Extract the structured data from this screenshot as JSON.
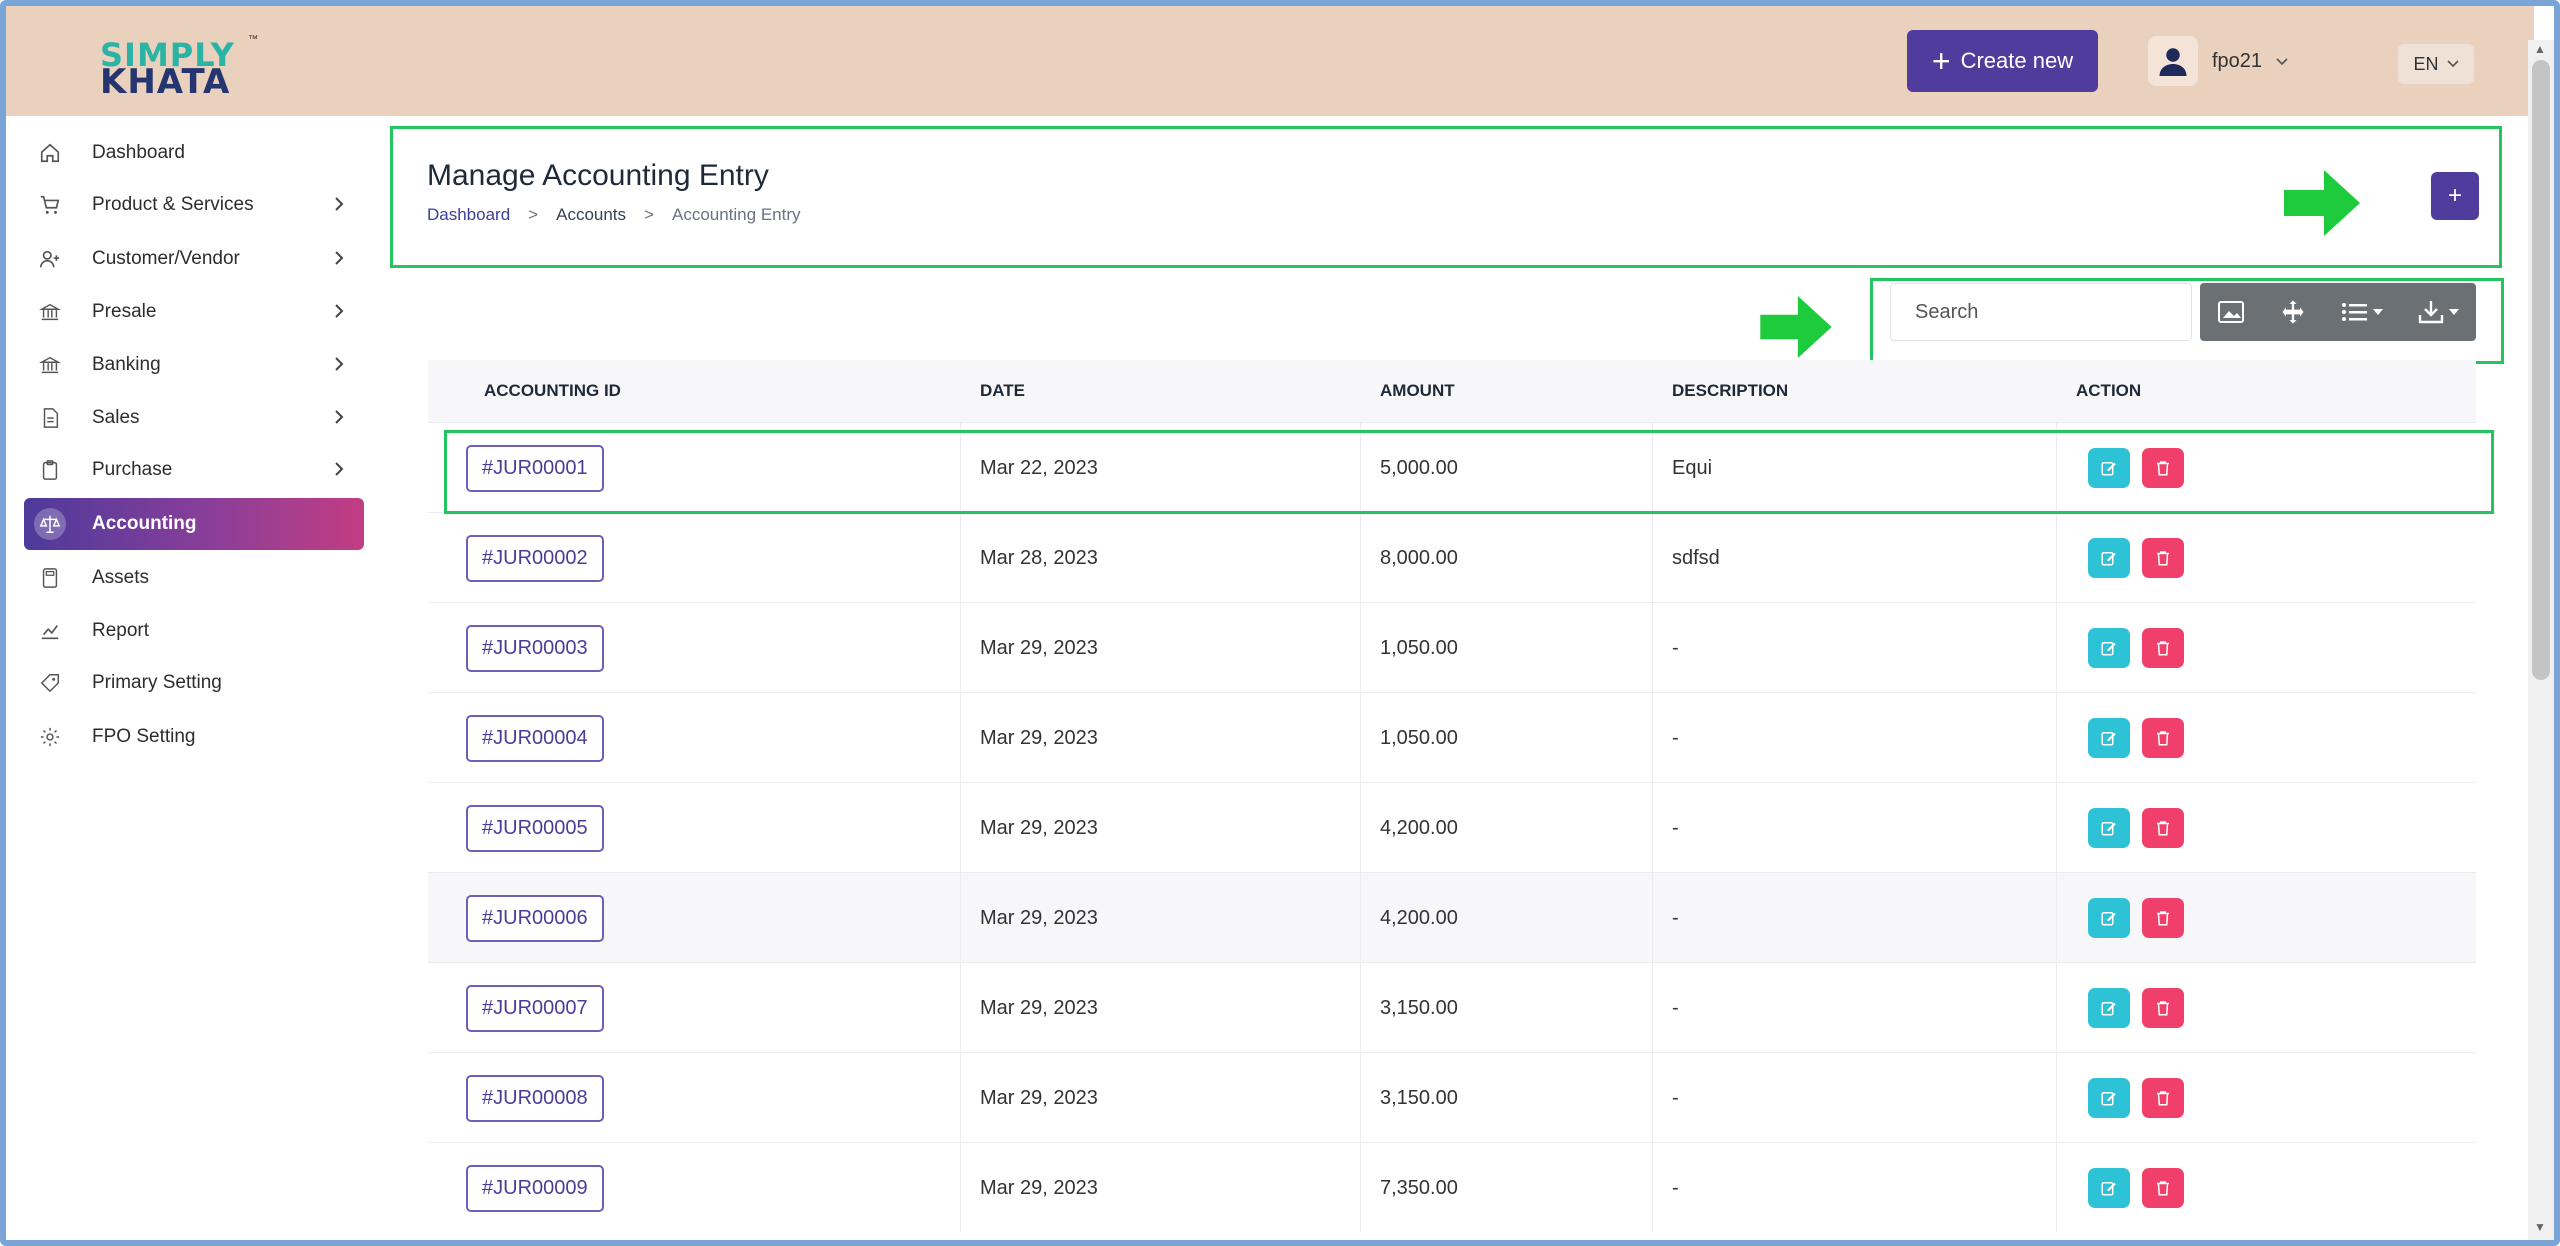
{
  "header": {
    "logo_top": "SIMPLY",
    "logo_bottom": "KHATA",
    "logo_tm": "™",
    "create_label": "Create new",
    "user_name": "fpo21",
    "lang": "EN"
  },
  "sidebar": {
    "items": [
      {
        "label": "Dashboard",
        "icon": "home-icon",
        "has_arrow": false
      },
      {
        "label": "Product & Services",
        "icon": "cart-icon",
        "has_arrow": true
      },
      {
        "label": "Customer/Vendor",
        "icon": "user-add-icon",
        "has_arrow": true
      },
      {
        "label": "Presale",
        "icon": "bank-icon",
        "has_arrow": true
      },
      {
        "label": "Banking",
        "icon": "bank-icon",
        "has_arrow": true
      },
      {
        "label": "Sales",
        "icon": "document-icon",
        "has_arrow": true
      },
      {
        "label": "Purchase",
        "icon": "clipboard-icon",
        "has_arrow": true
      },
      {
        "label": "Accounting",
        "icon": "scale-icon",
        "has_arrow": false,
        "active": true
      },
      {
        "label": "Assets",
        "icon": "calculator-icon",
        "has_arrow": false
      },
      {
        "label": "Report",
        "icon": "chart-icon",
        "has_arrow": false
      },
      {
        "label": "Primary Setting",
        "icon": "tag-icon",
        "has_arrow": false
      },
      {
        "label": "FPO Setting",
        "icon": "gear-icon",
        "has_arrow": false
      }
    ]
  },
  "page": {
    "title": "Manage Accounting Entry",
    "breadcrumb": [
      "Dashboard",
      "Accounts",
      "Accounting Entry"
    ],
    "breadcrumb_sep": ">",
    "add_label": "+"
  },
  "toolbar": {
    "search_placeholder": "Search"
  },
  "table": {
    "headers": [
      "ACCOUNTING ID",
      "DATE",
      "AMOUNT",
      "DESCRIPTION",
      "ACTION"
    ],
    "rows": [
      {
        "id": "#JUR00001",
        "date": "Mar 22, 2023",
        "amount": "5,000.00",
        "description": "Equi"
      },
      {
        "id": "#JUR00002",
        "date": "Mar 28, 2023",
        "amount": "8,000.00",
        "description": "sdfsd"
      },
      {
        "id": "#JUR00003",
        "date": "Mar 29, 2023",
        "amount": "1,050.00",
        "description": "-"
      },
      {
        "id": "#JUR00004",
        "date": "Mar 29, 2023",
        "amount": "1,050.00",
        "description": "-"
      },
      {
        "id": "#JUR00005",
        "date": "Mar 29, 2023",
        "amount": "4,200.00",
        "description": "-"
      },
      {
        "id": "#JUR00006",
        "date": "Mar 29, 2023",
        "amount": "4,200.00",
        "description": "-"
      },
      {
        "id": "#JUR00007",
        "date": "Mar 29, 2023",
        "amount": "3,150.00",
        "description": "-"
      },
      {
        "id": "#JUR00008",
        "date": "Mar 29, 2023",
        "amount": "3,150.00",
        "description": "-"
      },
      {
        "id": "#JUR00009",
        "date": "Mar 29, 2023",
        "amount": "7,350.00",
        "description": "-"
      }
    ]
  },
  "colors": {
    "accent": "#503c9c",
    "header_bg": "#ead1be",
    "highlight": "#22c55e",
    "edit": "#2ec2d6",
    "delete": "#ef3f6a"
  }
}
